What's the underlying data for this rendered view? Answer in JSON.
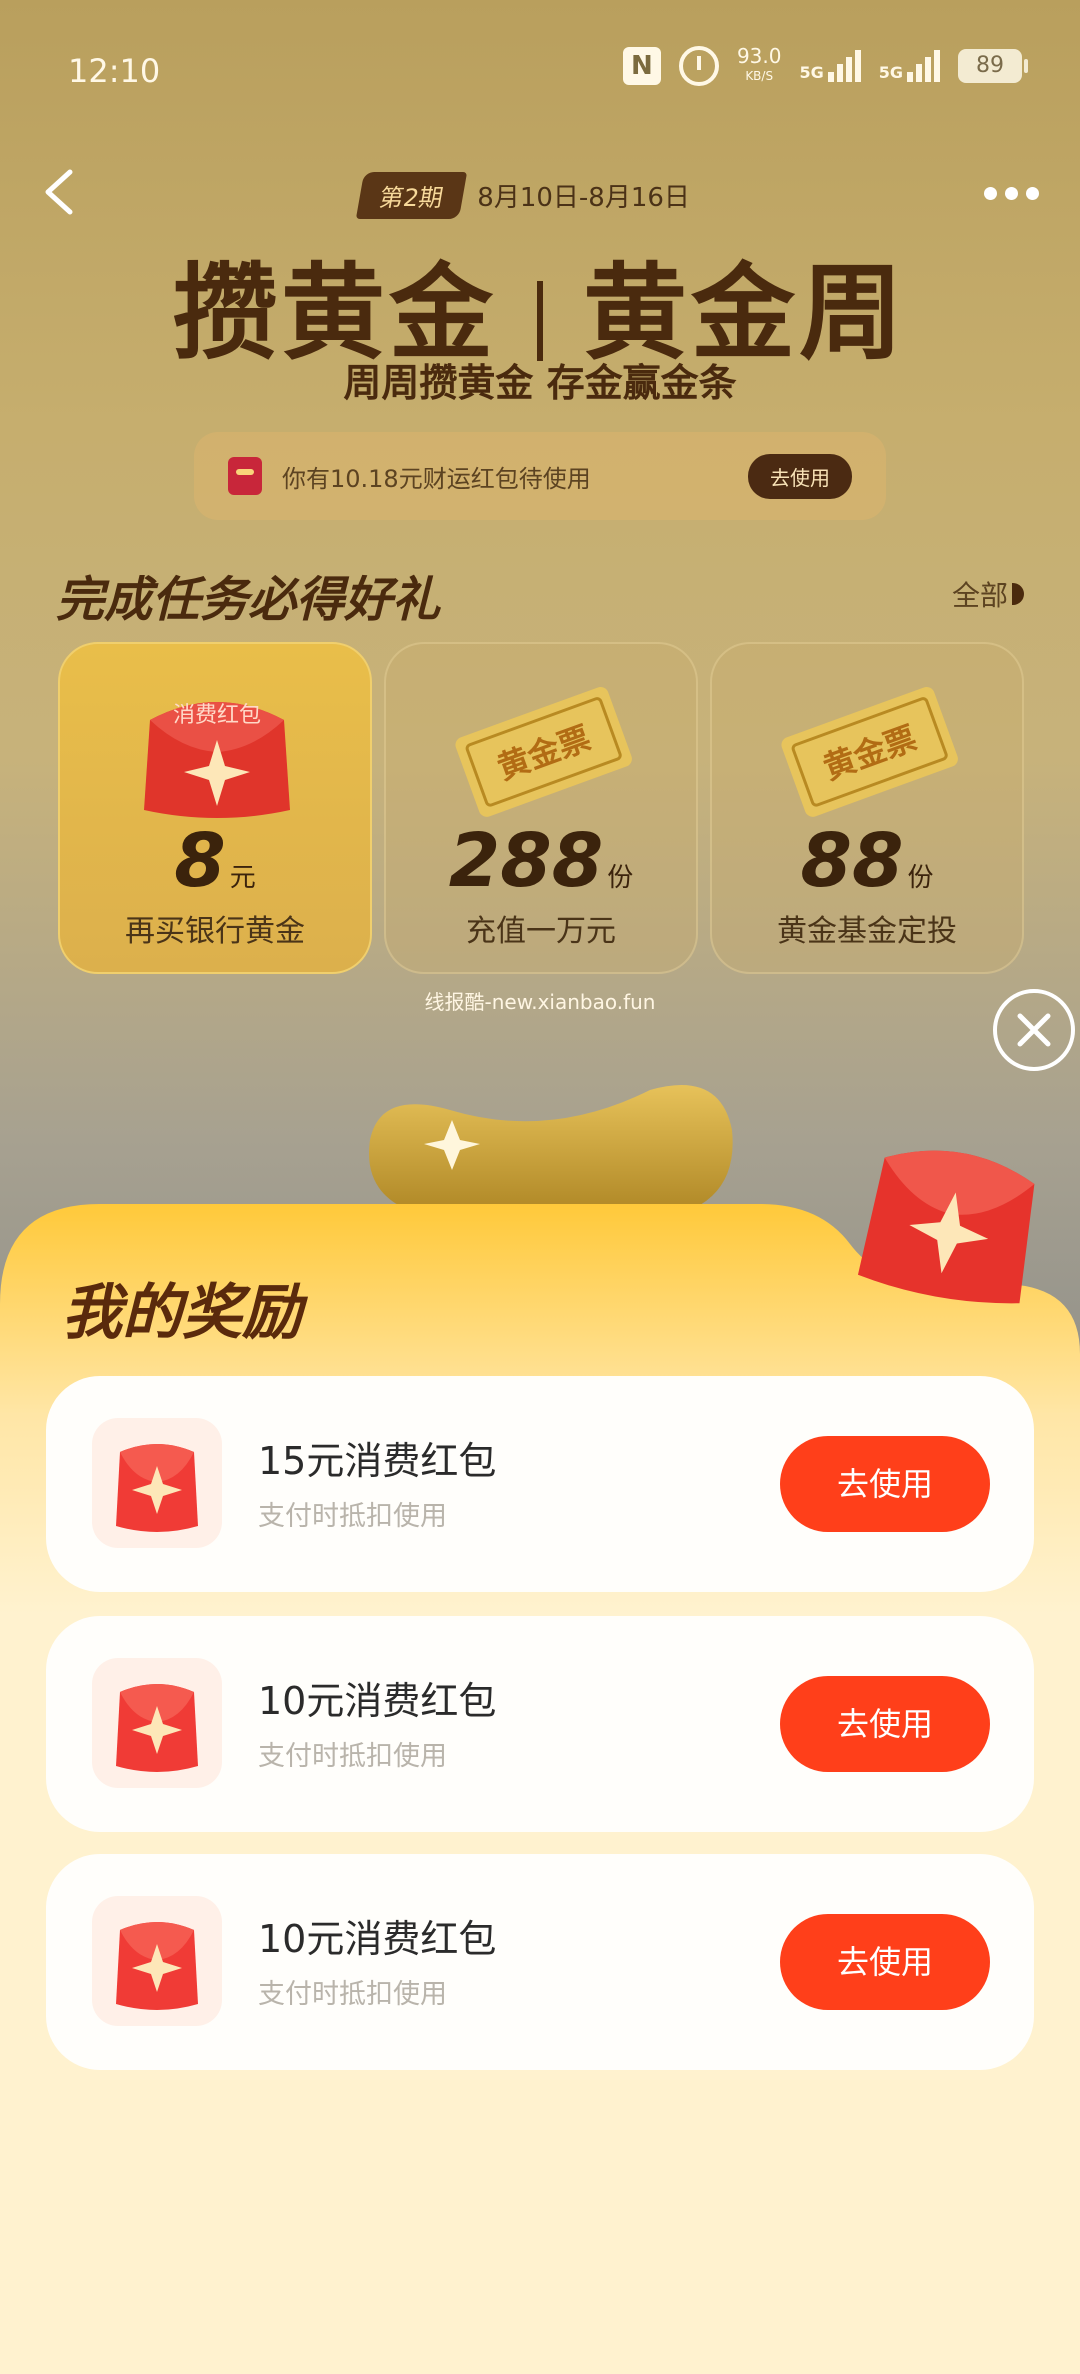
{
  "status_bar": {
    "time": "12:10",
    "speed_value": "93.0",
    "speed_unit": "KB/S",
    "network_1": "5G",
    "network_2": "5G",
    "battery": "89"
  },
  "header": {
    "period_badge": "第2期",
    "period_dates": "8月10日-8月16日",
    "title_left": "攒黄金",
    "title_right": "黄金周",
    "subtitle": "周周攒黄金 存金赢金条",
    "notice_text": "你有10.18元财运红包待使用",
    "notice_button": "去使用"
  },
  "tasks": {
    "title": "完成任务必得好礼",
    "all_label": "全部",
    "items": [
      {
        "image_label": "消费红包",
        "amount": "8",
        "unit": "元",
        "label": "再买银行黄金",
        "active": true
      },
      {
        "image_label": "黄金票",
        "amount": "288",
        "unit": "份",
        "label": "充值一万元",
        "active": false
      },
      {
        "image_label": "黄金票",
        "amount": "88",
        "unit": "份",
        "label": "黄金基金定投",
        "active": false
      }
    ]
  },
  "watermark": "线报酷-new.xianbao.fun",
  "rewards": {
    "title": "我的奖励",
    "items": [
      {
        "name": "15元消费红包",
        "desc": "支付时抵扣使用",
        "button": "去使用"
      },
      {
        "name": "10元消费红包",
        "desc": "支付时抵扣使用",
        "button": "去使用"
      },
      {
        "name": "10元消费红包",
        "desc": "支付时抵扣使用",
        "button": "去使用"
      }
    ]
  },
  "colors": {
    "accent_button": "#ff3f1a",
    "title_brown": "#4a2a0e",
    "sheet_top": "#ffc93a",
    "sheet_bottom": "#fff2cf"
  },
  "icons": [
    "nfc-icon",
    "alarm-icon",
    "signal-icon",
    "battery-icon",
    "back-icon",
    "more-icon",
    "close-icon",
    "red-packet-icon",
    "gold-ticket-icon",
    "gold-ingot-icon"
  ]
}
